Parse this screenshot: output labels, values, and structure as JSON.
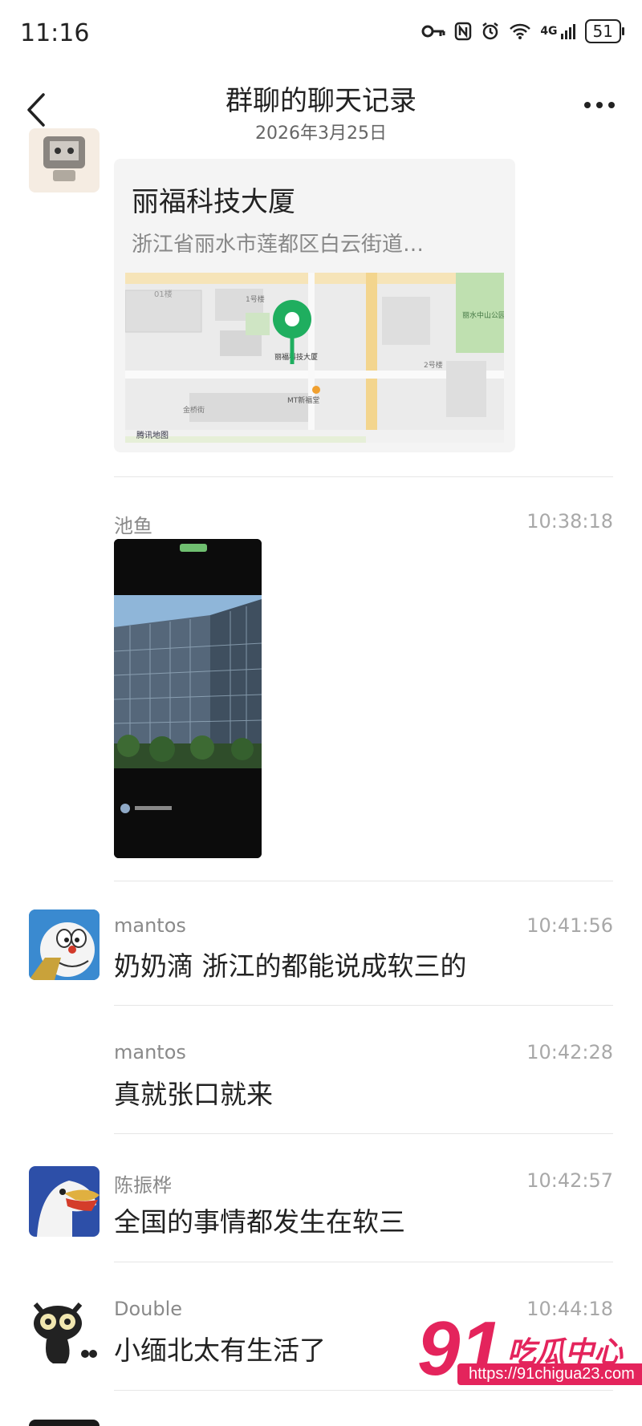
{
  "status_bar": {
    "time": "11:16",
    "battery": "51",
    "network": "4G"
  },
  "header": {
    "title": "群聊的聊天记录",
    "date": "2026年3月25日"
  },
  "location": {
    "name": "丽福科技大厦",
    "address": "浙江省丽水市莲都区白云街道…",
    "map_labels": [
      "丽福科技大厦",
      "MT新福堂",
      "丽水中山公园",
      "金桥街",
      "1号楼",
      "2号楼",
      "腾讯地图",
      "01楼"
    ]
  },
  "messages": [
    {
      "sender": "池鱼",
      "time": "10:38:18",
      "type": "image"
    },
    {
      "sender": "mantos",
      "time": "10:41:56",
      "text": "奶奶滴 浙江的都能说成软三的"
    },
    {
      "sender": "mantos",
      "time": "10:42:28",
      "text": "真就张口就来"
    },
    {
      "sender": "陈振桦",
      "time": "10:42:57",
      "text": "全国的事情都发生在软三"
    },
    {
      "sender": "Double",
      "time": "10:44:18",
      "text": "小缅北太有生活了"
    }
  ],
  "watermark": {
    "brand": "吃瓜中心",
    "number": "91",
    "url": "https://91chigua23.com"
  },
  "colors": {
    "map_pin": "#1fae5f",
    "watermark": "#e4245c"
  }
}
